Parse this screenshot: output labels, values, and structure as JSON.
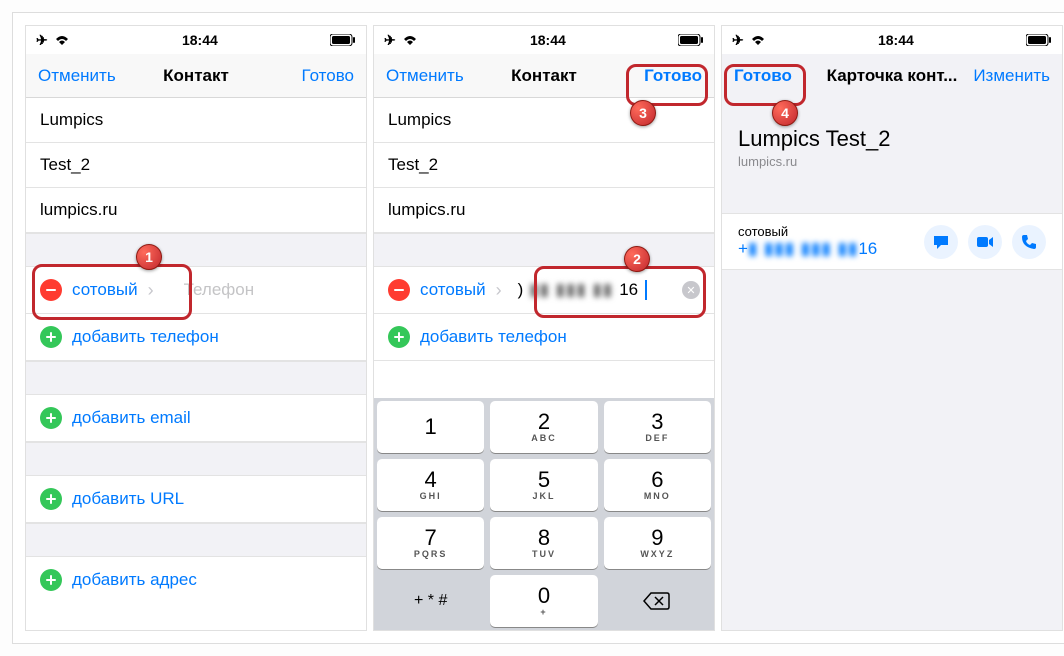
{
  "status": {
    "time": "18:44"
  },
  "screen1": {
    "nav": {
      "left": "Отменить",
      "title": "Контакт",
      "right": "Готово"
    },
    "fields": {
      "first": "Lumpics",
      "last": "Test_2",
      "company": "lumpics.ru"
    },
    "phone_row": {
      "label": "сотовый",
      "placeholder": "Телефон"
    },
    "add_phone": "добавить телефон",
    "add_email": "добавить email",
    "add_url": "добавить URL",
    "add_address": "добавить адрес"
  },
  "screen2": {
    "nav": {
      "left": "Отменить",
      "title": "Контакт",
      "right": "Готово"
    },
    "fields": {
      "first": "Lumpics",
      "last": "Test_2",
      "company": "lumpics.ru"
    },
    "phone_row": {
      "label": "сотовый",
      "value_prefix": ") ",
      "value_hidden": "▮▮ ▮▮▮ ▮▮",
      "value_suffix": "16"
    },
    "add_phone": "добавить телефон",
    "keypad": {
      "rows": [
        [
          {
            "d": "1",
            "l": ""
          },
          {
            "d": "2",
            "l": "ABC"
          },
          {
            "d": "3",
            "l": "DEF"
          }
        ],
        [
          {
            "d": "4",
            "l": "GHI"
          },
          {
            "d": "5",
            "l": "JKL"
          },
          {
            "d": "6",
            "l": "MNO"
          }
        ],
        [
          {
            "d": "7",
            "l": "PQRS"
          },
          {
            "d": "8",
            "l": "TUV"
          },
          {
            "d": "9",
            "l": "WXYZ"
          }
        ]
      ],
      "bottom": {
        "sym": "+ * #",
        "zero_d": "0",
        "zero_l": "+"
      }
    }
  },
  "screen3": {
    "nav": {
      "left": "Готово",
      "title": "Карточка конт...",
      "right": "Изменить"
    },
    "card": {
      "name": "Lumpics Test_2",
      "sub": "lumpics.ru",
      "phone_label": "сотовый",
      "phone_prefix": "+",
      "phone_hidden": "▮ ▮▮▮ ▮▮▮ ▮▮",
      "phone_suffix": "16"
    }
  },
  "anno": {
    "n1": "1",
    "n2": "2",
    "n3": "3",
    "n4": "4"
  }
}
